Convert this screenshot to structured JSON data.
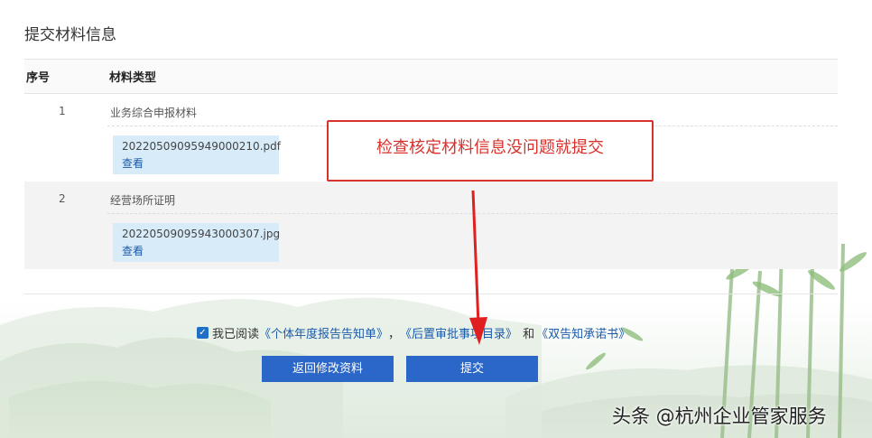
{
  "section": {
    "title": "提交材料信息"
  },
  "table": {
    "headers": {
      "no": "序号",
      "type": "材料类型"
    },
    "rows": [
      {
        "no": "1",
        "type": "业务综合申报材料",
        "file": "20220509095949000210.pdf",
        "view": "查看"
      },
      {
        "no": "2",
        "type": "经营场所证明",
        "file": "20220509095943000307.jpg",
        "view": "查看"
      }
    ]
  },
  "annotation": {
    "text": "检查核定材料信息没问题就提交",
    "color": "#d9322d"
  },
  "agreement": {
    "checked": true,
    "prefix": "我已阅读",
    "link1": "《个体年度报告告知单》",
    "sep": "，",
    "link2": "《后置审批事项目录》",
    "and": "和",
    "link3": "《双告知承诺书》"
  },
  "buttons": {
    "back": "返回修改资料",
    "submit": "提交"
  },
  "watermark": "头条 @杭州企业管家服务",
  "colors": {
    "primary_button": "#2a67c9",
    "link": "#1d5aa8",
    "file_bg": "#d8ebf9"
  }
}
